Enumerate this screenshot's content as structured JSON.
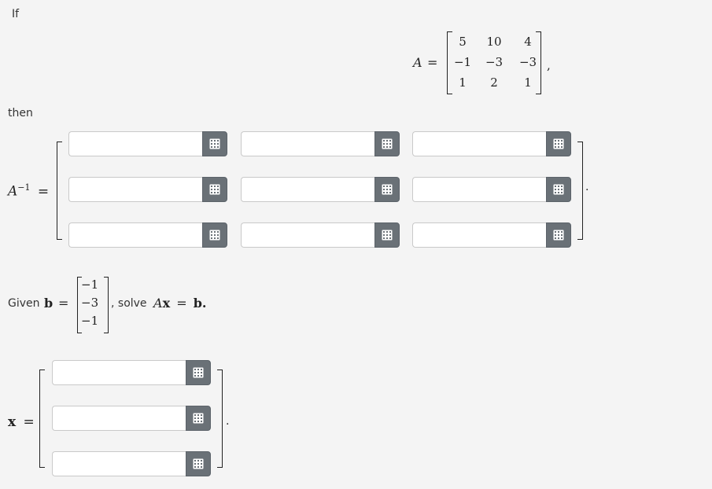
{
  "labels": {
    "if": "If",
    "then": "then",
    "given": "Given",
    "solve": ", solve",
    "comma": ",",
    "period": "."
  },
  "math": {
    "A": "A",
    "eq": "=",
    "Ainv_base": "A",
    "Ainv_exp": "−1",
    "b": "b",
    "Ax_A": "A",
    "Ax_x": "x",
    "b_end": "b.",
    "x": "x"
  },
  "matrix_A": {
    "rows": [
      [
        "5",
        "10",
        "4"
      ],
      [
        "−1",
        "−3",
        "−3"
      ],
      [
        "1",
        "2",
        "1"
      ]
    ]
  },
  "vector_b": [
    "−1",
    "−3",
    "−1"
  ],
  "inverse_inputs": {
    "rows": [
      [
        {
          "value": ""
        },
        {
          "value": ""
        },
        {
          "value": ""
        }
      ],
      [
        {
          "value": ""
        },
        {
          "value": ""
        },
        {
          "value": ""
        }
      ],
      [
        {
          "value": ""
        },
        {
          "value": ""
        },
        {
          "value": ""
        }
      ]
    ]
  },
  "x_inputs": [
    {
      "value": ""
    },
    {
      "value": ""
    },
    {
      "value": ""
    }
  ],
  "icons": {
    "keypad": "keypad-icon",
    "button_color": "#6a7177"
  }
}
